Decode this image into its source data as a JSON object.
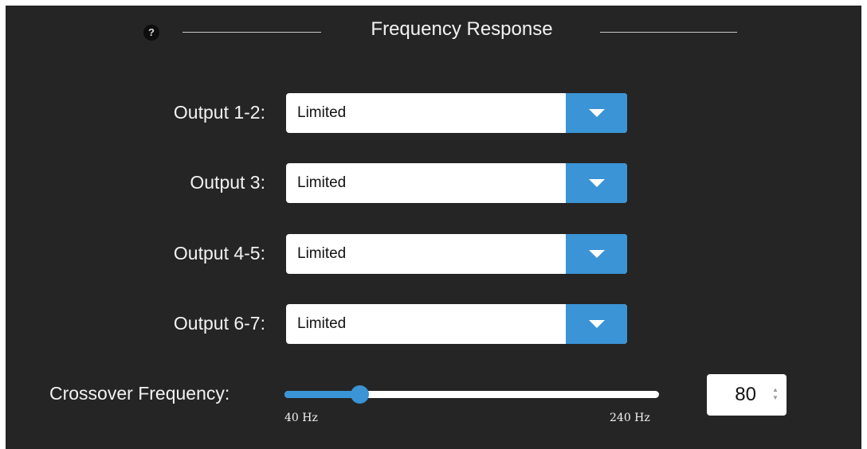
{
  "header": {
    "help_icon": "?",
    "title": "Frequency Response"
  },
  "outputs": [
    {
      "label": "Output 1-2:",
      "value": "Limited"
    },
    {
      "label": "Output 3:",
      "value": "Limited"
    },
    {
      "label": "Output 4-5:",
      "value": "Limited"
    },
    {
      "label": "Output 6-7:",
      "value": "Limited"
    }
  ],
  "crossover": {
    "label": "Crossover Frequency:",
    "min_label": "40 Hz",
    "max_label": "240 Hz",
    "min": 40,
    "max": 240,
    "value": 80,
    "value_text": "80"
  },
  "icons": {
    "dropdown": "chevron-down-icon",
    "help": "help-icon",
    "spinner": "spinner-icon"
  },
  "colors": {
    "panel_bg": "#252525",
    "accent": "#3a94d6",
    "text": "#f2f2f2"
  }
}
